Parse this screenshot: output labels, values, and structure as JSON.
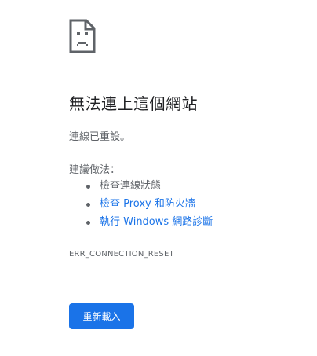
{
  "icon": "sad-document-icon",
  "title": "無法連上這個網站",
  "message": "連線已重設。",
  "suggestions_heading": "建議做法：",
  "suggestions": [
    {
      "label": "檢查連線狀態",
      "link": false
    },
    {
      "label": "檢查 Proxy 和防火牆",
      "link": true
    },
    {
      "label": "執行 Windows 網路診斷",
      "link": true
    }
  ],
  "error_code": "ERR_CONNECTION_RESET",
  "reload_button": "重新載入",
  "colors": {
    "accent": "#1a73e8",
    "text": "#202124",
    "secondary_text": "#5f6368"
  }
}
